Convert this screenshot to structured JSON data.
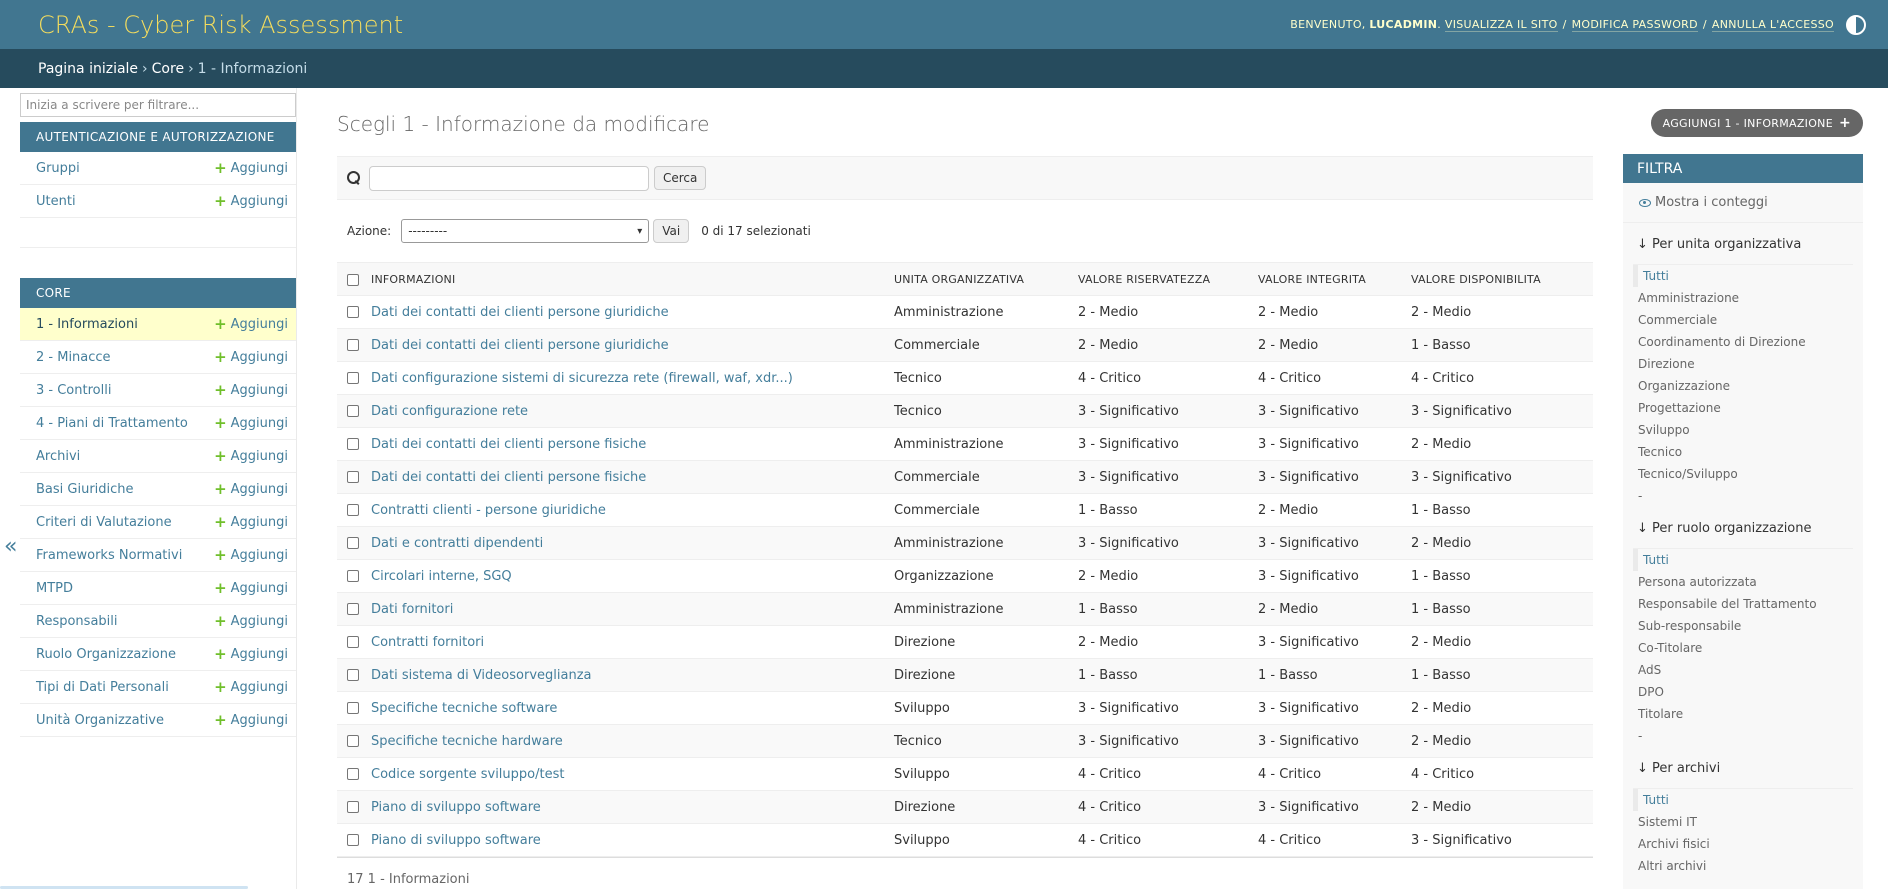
{
  "header": {
    "site_name": "CRAs - Cyber Risk Assessment",
    "welcome": "Benvenuto,",
    "username": "LUCADMIN",
    "view_site": "Visualizza il sito",
    "change_password": "Modifica password",
    "logout": "Annulla l'accesso"
  },
  "breadcrumbs": {
    "home": "Pagina iniziale",
    "app": "Core",
    "current": "1 - Informazioni"
  },
  "nav": {
    "filter_placeholder": "Inizia a scrivere per filtrare...",
    "toggle": "«",
    "add_label": "Aggiungi",
    "auth": {
      "caption": "Autenticazione e Autorizzazione",
      "items": [
        "Gruppi",
        "Utenti"
      ]
    },
    "core": {
      "caption": "Core",
      "items": [
        "1 - Informazioni",
        "2 - Minacce",
        "3 - Controlli",
        "4 - Piani di Trattamento",
        "Archivi",
        "Basi Giuridiche",
        "Criteri di Valutazione",
        "Frameworks Normativi",
        "MTPD",
        "Responsabili",
        "Ruolo Organizzazione",
        "Tipi di Dati Personali",
        "Unità Organizzative"
      ]
    }
  },
  "content": {
    "title": "Scegli 1 - Informazione da modificare",
    "add_button": "Aggiungi 1 - Informazione",
    "search_button": "Cerca",
    "action_label": "Azione:",
    "action_value": "---------",
    "go_button": "Vai",
    "selected_count": "0 di 17 selezionati",
    "columns": [
      "Informazioni",
      "Unita organizzativa",
      "Valore riservatezza",
      "Valore integrita",
      "Valore disponibilita"
    ],
    "rows": [
      [
        "Dati dei contatti dei clienti persone giuridiche",
        "Amministrazione",
        "2 - Medio",
        "2 - Medio",
        "2 - Medio"
      ],
      [
        "Dati dei contatti dei clienti persone giuridiche",
        "Commerciale",
        "2 - Medio",
        "2 - Medio",
        "1 - Basso"
      ],
      [
        "Dati configurazione sistemi di sicurezza rete (firewall, waf, xdr...)",
        "Tecnico",
        "4 - Critico",
        "4 - Critico",
        "4 - Critico"
      ],
      [
        "Dati configurazione rete",
        "Tecnico",
        "3 - Significativo",
        "3 - Significativo",
        "3 - Significativo"
      ],
      [
        "Dati dei contatti dei clienti persone fisiche",
        "Amministrazione",
        "3 - Significativo",
        "3 - Significativo",
        "2 - Medio"
      ],
      [
        "Dati dei contatti dei clienti persone fisiche",
        "Commerciale",
        "3 - Significativo",
        "3 - Significativo",
        "3 - Significativo"
      ],
      [
        "Contratti clienti - persone giuridiche",
        "Commerciale",
        "1 - Basso",
        "2 - Medio",
        "1 - Basso"
      ],
      [
        "Dati e contratti dipendenti",
        "Amministrazione",
        "3 - Significativo",
        "3 - Significativo",
        "2 - Medio"
      ],
      [
        "Circolari interne, SGQ",
        "Organizzazione",
        "2 - Medio",
        "3 - Significativo",
        "1 - Basso"
      ],
      [
        "Dati fornitori",
        "Amministrazione",
        "1 - Basso",
        "2 - Medio",
        "1 - Basso"
      ],
      [
        "Contratti fornitori",
        "Direzione",
        "2 - Medio",
        "3 - Significativo",
        "2 - Medio"
      ],
      [
        "Dati sistema di Videosorveglianza",
        "Direzione",
        "1 - Basso",
        "1 - Basso",
        "1 - Basso"
      ],
      [
        "Specifiche tecniche software",
        "Sviluppo",
        "3 - Significativo",
        "3 - Significativo",
        "2 - Medio"
      ],
      [
        "Specifiche tecniche hardware",
        "Tecnico",
        "3 - Significativo",
        "3 - Significativo",
        "2 - Medio"
      ],
      [
        "Codice sorgente sviluppo/test",
        "Sviluppo",
        "4 - Critico",
        "4 - Critico",
        "4 - Critico"
      ],
      [
        "Piano di sviluppo software",
        "Direzione",
        "4 - Critico",
        "3 - Significativo",
        "2 - Medio"
      ],
      [
        "Piano di sviluppo software",
        "Sviluppo",
        "4 - Critico",
        "4 - Critico",
        "3 - Significativo"
      ]
    ],
    "paginator": "17 1 - Informazioni"
  },
  "filter": {
    "title": "Filtra",
    "show_counts": "Mostra i conteggi",
    "groups": [
      {
        "title": "↓ Per unita organizzativa",
        "options": [
          "Tutti",
          "Amministrazione",
          "Commerciale",
          "Coordinamento di Direzione",
          "Direzione",
          "Organizzazione",
          "Progettazione",
          "Sviluppo",
          "Tecnico",
          "Tecnico/Sviluppo",
          "-"
        ]
      },
      {
        "title": "↓ Per ruolo organizzazione",
        "options": [
          "Tutti",
          "Persona autorizzata",
          "Responsabile del Trattamento",
          "Sub-responsabile",
          "Co-Titolare",
          "AdS",
          "DPO",
          "Titolare",
          "-"
        ]
      },
      {
        "title": "↓ Per archivi",
        "options": [
          "Tutti",
          "Sistemi IT",
          "Archivi fisici",
          "Altri archivi"
        ]
      }
    ]
  }
}
